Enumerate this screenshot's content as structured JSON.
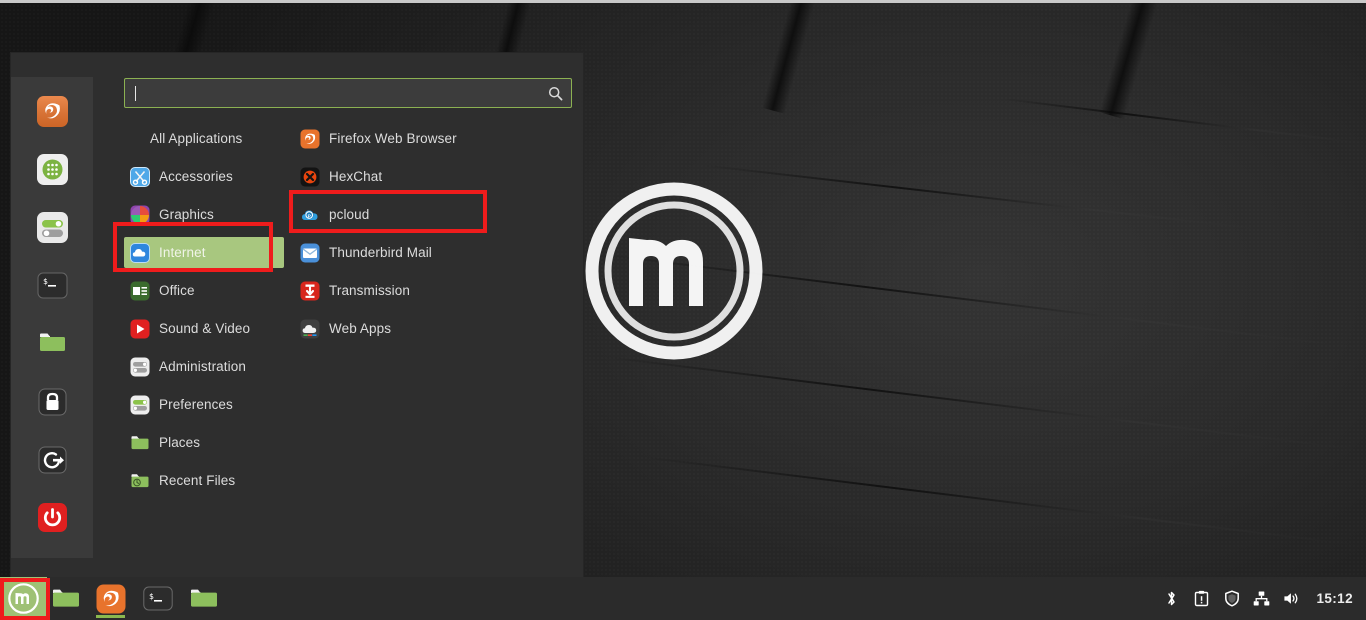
{
  "desktop": {
    "wallpaper_logo": "linux-mint-logo",
    "background_color": "#1d1d1d"
  },
  "menu": {
    "search": {
      "value": "",
      "placeholder": "",
      "icon": "search-icon",
      "border_color": "#8cb152"
    },
    "sidebar_buttons": [
      {
        "name": "firefox-web-browser",
        "icon": "firefox-icon"
      },
      {
        "name": "software-manager",
        "icon": "software-manager-icon"
      },
      {
        "name": "system-settings",
        "icon": "system-settings-icon"
      },
      {
        "name": "terminal",
        "icon": "terminal-icon"
      },
      {
        "name": "files",
        "icon": "folder-icon"
      },
      {
        "name": "lock-screen",
        "icon": "lock-icon"
      },
      {
        "name": "log-out",
        "icon": "logout-icon"
      },
      {
        "name": "quit",
        "icon": "power-icon"
      }
    ],
    "categories": [
      {
        "label": "All Applications",
        "icon": "none",
        "selected": false
      },
      {
        "label": "Accessories",
        "icon": "accessories-icon",
        "selected": false
      },
      {
        "label": "Graphics",
        "icon": "graphics-icon",
        "selected": false
      },
      {
        "label": "Internet",
        "icon": "internet-icon",
        "selected": true
      },
      {
        "label": "Office",
        "icon": "office-icon",
        "selected": false
      },
      {
        "label": "Sound & Video",
        "icon": "sound-video-icon",
        "selected": false
      },
      {
        "label": "Administration",
        "icon": "administration-icon",
        "selected": false
      },
      {
        "label": "Preferences",
        "icon": "preferences-icon",
        "selected": false
      },
      {
        "label": "Places",
        "icon": "places-icon",
        "selected": false
      },
      {
        "label": "Recent Files",
        "icon": "recent-files-icon",
        "selected": false
      }
    ],
    "applications": [
      {
        "label": "Firefox Web Browser",
        "icon": "firefox-icon"
      },
      {
        "label": "HexChat",
        "icon": "hexchat-icon"
      },
      {
        "label": "pcloud",
        "icon": "pcloud-icon"
      },
      {
        "label": "Thunderbird Mail",
        "icon": "thunderbird-icon"
      },
      {
        "label": "Transmission",
        "icon": "transmission-icon"
      },
      {
        "label": "Web Apps",
        "icon": "web-apps-icon"
      }
    ],
    "selected_category": "Internet",
    "highlight_color": "#a8c77f"
  },
  "annotations": {
    "color": "#ef1c1c",
    "boxes": [
      {
        "name": "internet-category",
        "target": "Internet"
      },
      {
        "name": "pcloud-app",
        "target": "pcloud"
      },
      {
        "name": "menu-button",
        "target": "Menu"
      }
    ]
  },
  "taskbar": {
    "menu_button": {
      "name": "mint-menu-button",
      "icon": "mint-logo-icon"
    },
    "items": [
      {
        "name": "window-files-1",
        "icon": "folder-icon",
        "active": false
      },
      {
        "name": "window-firefox",
        "icon": "firefox-icon",
        "active": true
      },
      {
        "name": "window-terminal",
        "icon": "terminal-icon",
        "active": false
      },
      {
        "name": "window-files-2",
        "icon": "folder-icon",
        "active": false
      }
    ],
    "tray": [
      {
        "name": "bluetooth",
        "icon": "bluetooth-icon"
      },
      {
        "name": "update-manager",
        "icon": "clipboard-icon"
      },
      {
        "name": "firewall",
        "icon": "shield-icon"
      },
      {
        "name": "network",
        "icon": "network-icon"
      },
      {
        "name": "volume",
        "icon": "speaker-icon"
      }
    ],
    "clock": "15:12"
  }
}
